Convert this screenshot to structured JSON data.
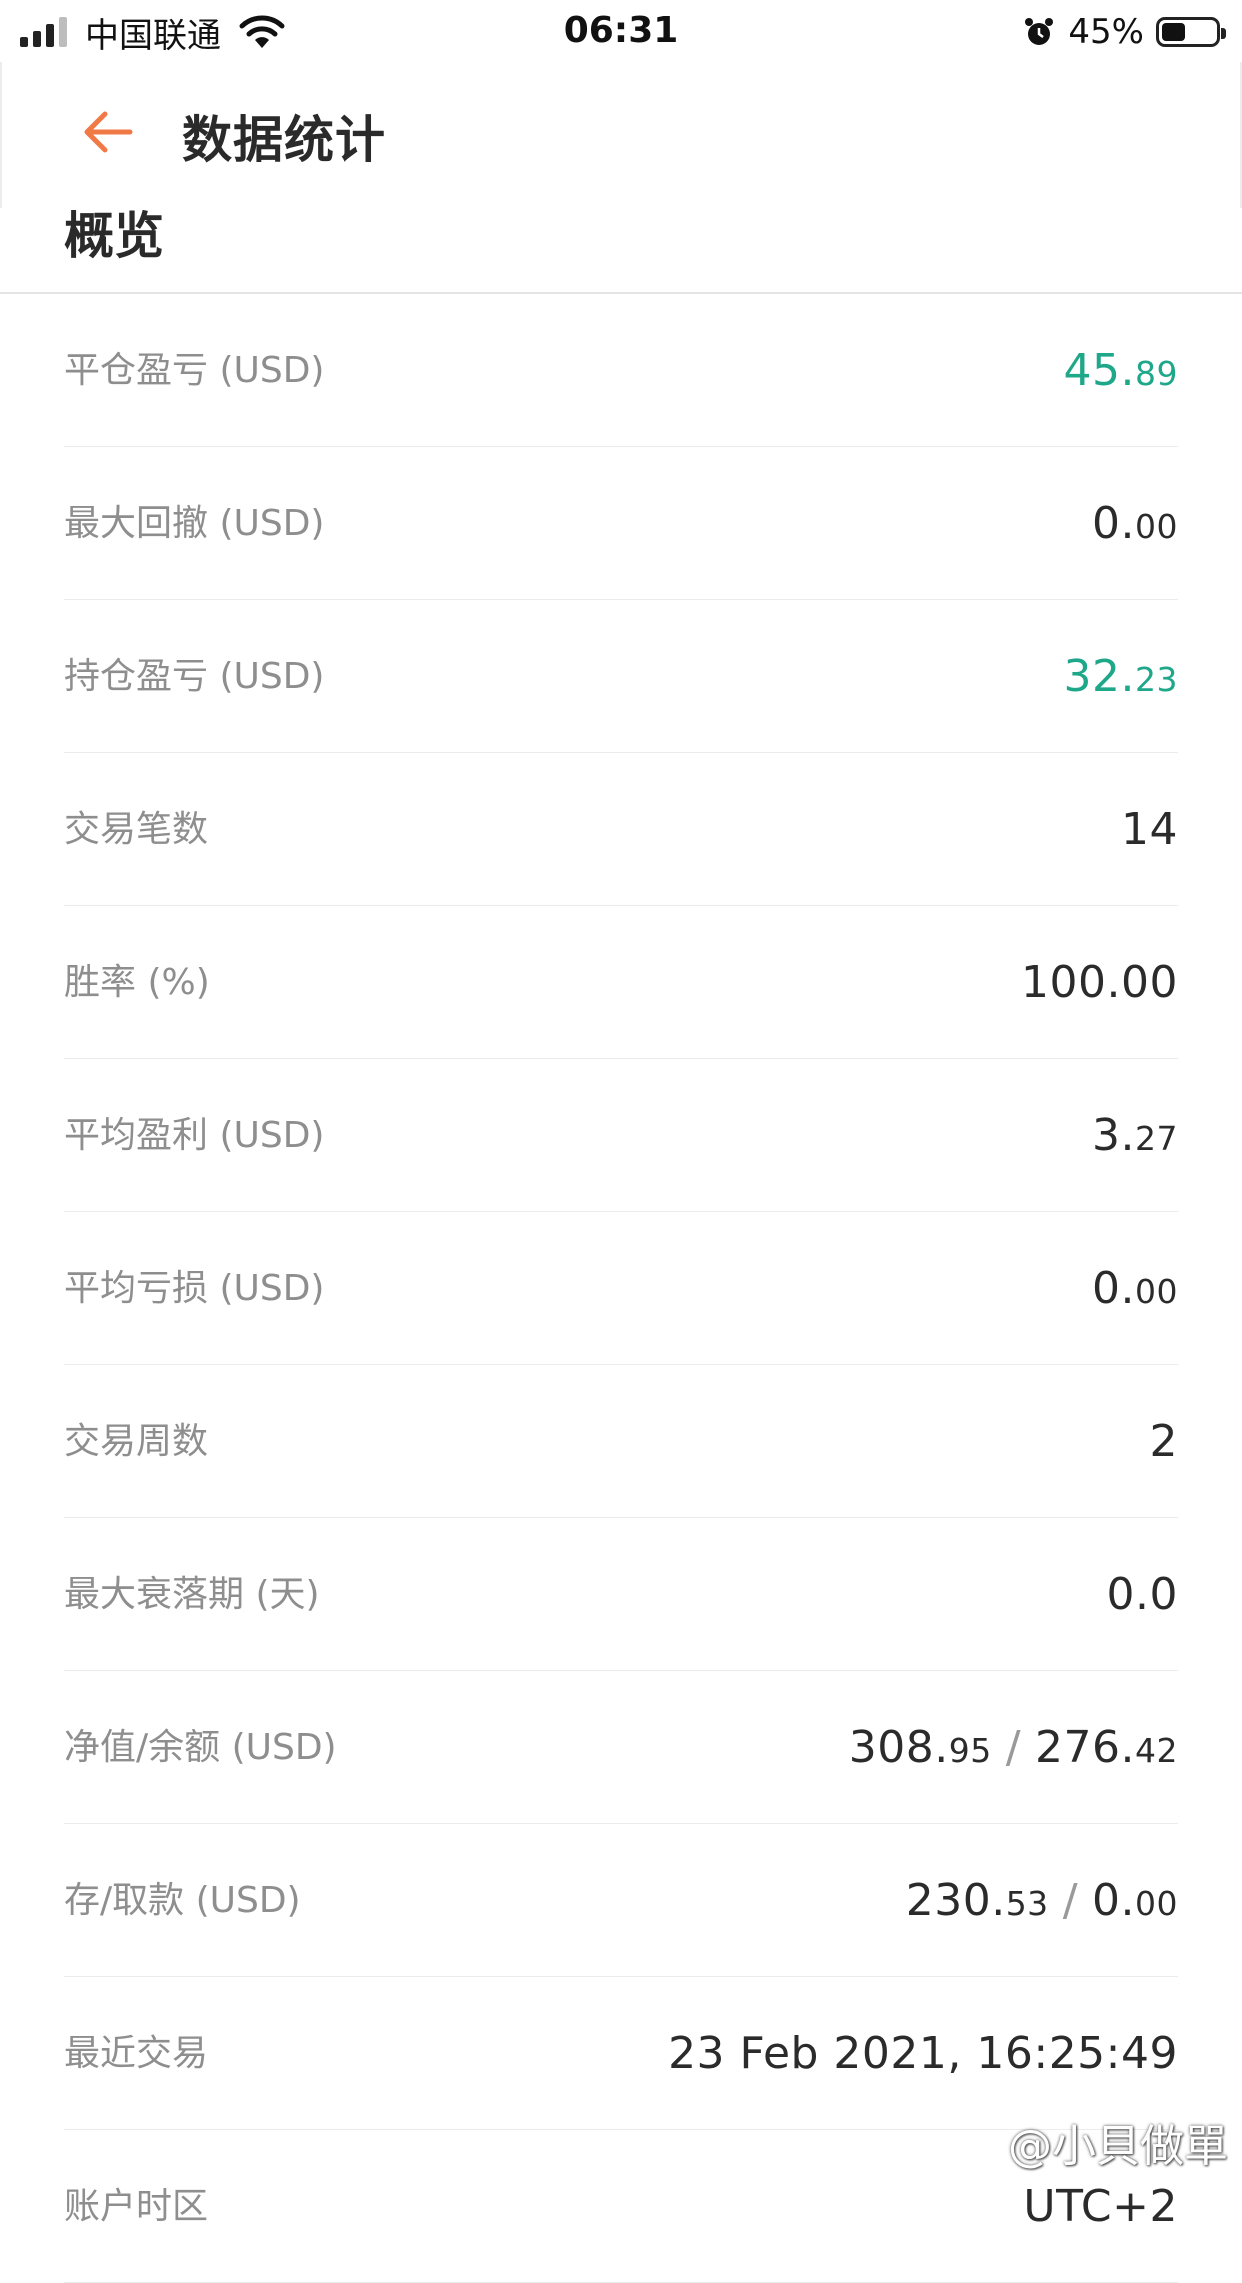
{
  "status_bar": {
    "carrier": "中国联通",
    "time": "06:31",
    "battery_percent": "45%",
    "battery_level": 0.45
  },
  "nav": {
    "title": "数据统计"
  },
  "section": {
    "title": "概览"
  },
  "rows": [
    {
      "label": "平仓盈亏 (USD)",
      "int": "45.",
      "dec": "89",
      "color": "#1fa78a"
    },
    {
      "label": "最大回撤 (USD)",
      "int": "0.",
      "dec": "00"
    },
    {
      "label": "持仓盈亏 (USD)",
      "int": "32.",
      "dec": "23",
      "color": "#1fa78a"
    },
    {
      "label": "交易笔数",
      "int": "14"
    },
    {
      "label": "胜率 (%)",
      "int": "100.00"
    },
    {
      "label": "平均盈利 (USD)",
      "int": "3.",
      "dec": "27"
    },
    {
      "label": "平均亏损 (USD)",
      "int": "0.",
      "dec": "00"
    },
    {
      "label": "交易周数",
      "int": "2"
    },
    {
      "label": "最大衰落期 (天)",
      "int": "0.0"
    },
    {
      "label": "净值/余额 (USD)",
      "int": "308.",
      "dec": "95",
      "sep": "/",
      "int2": "276.",
      "dec2": "42"
    },
    {
      "label": "存/取款 (USD)",
      "int": "230.",
      "dec": "53",
      "sep": "/",
      "int2": "0.",
      "dec2": "00"
    },
    {
      "label": "最近交易",
      "int": "23 Feb 2021, 16:25:49"
    },
    {
      "label": "账户时区",
      "int": "UTC+2"
    }
  ],
  "watermark": "@小貝做單"
}
